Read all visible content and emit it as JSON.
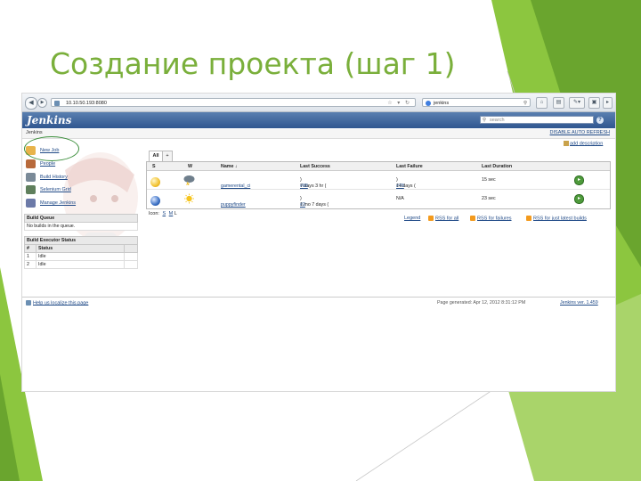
{
  "slide": {
    "title": "Создание проекта (шаг 1)",
    "accent_color": "#7aaf3b"
  },
  "browser": {
    "url": "10.10.50.193:8080",
    "search_query": "jenkins",
    "back_icon": "back-arrow-icon",
    "forward_icon": "forward-arrow-icon"
  },
  "jenkins": {
    "logo": "Jenkins",
    "search_placeholder": "search",
    "breadcrumb": "Jenkins",
    "auto_refresh": "DISABLE AUTO REFRESH",
    "add_description": "add description",
    "sidebar": [
      {
        "label": "New Job",
        "icon": "new-job-icon"
      },
      {
        "label": "People",
        "icon": "people-icon"
      },
      {
        "label": "Build History",
        "icon": "build-history-icon"
      },
      {
        "label": "Selenium Grid",
        "icon": "selenium-grid-icon"
      },
      {
        "label": "Manage Jenkins",
        "icon": "manage-jenkins-icon"
      }
    ],
    "build_queue": {
      "title": "Build Queue",
      "empty": "No builds in the queue."
    },
    "executor_status": {
      "title": "Build Executor Status",
      "col_num": "#",
      "col_status": "Status",
      "rows": [
        {
          "num": "1",
          "status": "Idle"
        },
        {
          "num": "2",
          "status": "Idle"
        }
      ]
    },
    "tabs": [
      "All",
      "+"
    ],
    "columns": {
      "s": "S",
      "w": "W",
      "name": "Name ↓",
      "last_success": "Last Success",
      "last_failure": "Last Failure",
      "last_duration": "Last Duration"
    },
    "jobs": [
      {
        "status_color": "#f2c230",
        "weather_icon": "storm-cloud-icon",
        "name": "gamerental_ci",
        "last_success": "7 days 3 hr (",
        "last_success_build": "#88",
        "last_failure": "14 days (",
        "last_failure_build": "#78",
        "last_duration": "15 sec"
      },
      {
        "status_color": "#3a6fc4",
        "weather_icon": "sun-icon",
        "name": "puppyfinder",
        "last_success": "1 mo 7 days (",
        "last_success_build": "#2",
        "last_failure": "N/A",
        "last_failure_build": "",
        "last_duration": "23 sec"
      }
    ],
    "icon_label": "Icon:",
    "icon_sizes": [
      "S",
      "M",
      "L"
    ],
    "legend": "Legend",
    "rss_all": "RSS for all",
    "rss_failures": "RSS for failures",
    "rss_latest": "RSS for just latest builds",
    "localize": "Help us localize this page",
    "generated": "Page generated: Apr 12, 2012 8:31:12 PM",
    "version": "Jenkins ver. 1.459"
  }
}
